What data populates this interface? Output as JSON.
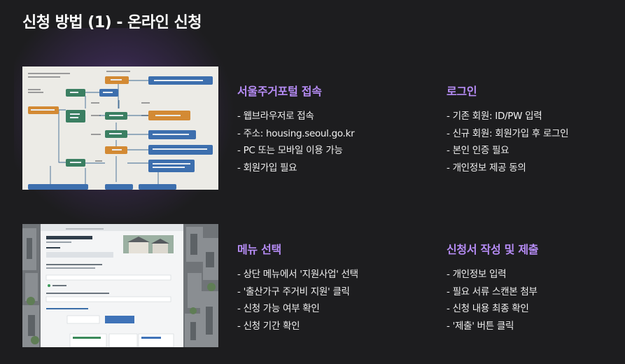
{
  "page_title": "신청 방법 (1) - 온라인 신청",
  "cards": [
    {
      "title": "서울주거포털 접속",
      "items": [
        "- 웹브라우저로 접속",
        "- 주소: housing.seoul.go.kr",
        "- PC 또는 모바일 이용 가능",
        "- 회원가입 필요"
      ]
    },
    {
      "title": "로그인",
      "items": [
        "- 기존 회원: ID/PW 입력",
        "- 신규 회원: 회원가입 후 로그인",
        "- 본인 인증 필요",
        "- 개인정보 제공 동의"
      ]
    },
    {
      "title": "메뉴 선택",
      "items": [
        "- 상단 메뉴에서 '지원사업' 선택",
        "- '출산가구 주거비 지원' 클릭",
        "- 신청 가능 여부 확인",
        "- 신청 기간 확인"
      ]
    },
    {
      "title": "신청서 작성 및 제출",
      "items": [
        "- 개인정보 입력",
        "- 필요 서류 스캔본 첨부",
        "- 신청 내용 최종 확인",
        "- '제출' 버튼 클릭"
      ]
    }
  ],
  "colors": {
    "background": "#1d1d1f",
    "accent": "#b68cf5",
    "glow": "#8c5ad2"
  }
}
